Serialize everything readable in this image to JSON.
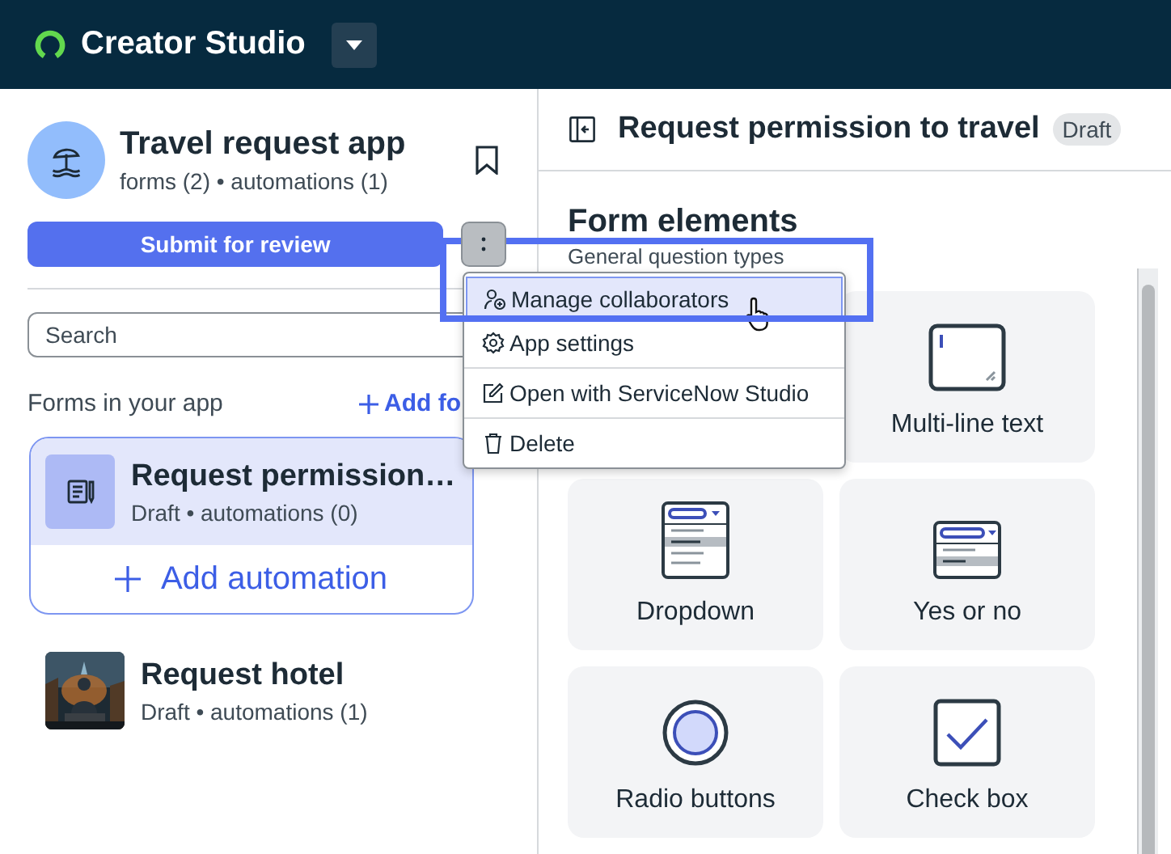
{
  "header": {
    "title": "Creator Studio"
  },
  "app": {
    "name": "Travel request app",
    "summary": "forms (2) • automations (1)"
  },
  "submit_button": "Submit for review",
  "search": {
    "placeholder": "Search"
  },
  "forms_section": {
    "label": "Forms in your app",
    "add_link": "Add fo"
  },
  "forms": [
    {
      "title": "Request permission…",
      "subtitle": "Draft • automations (0)",
      "selected": true,
      "kind": "icon",
      "add_action": "Add automation"
    },
    {
      "title": "Request hotel",
      "subtitle": "Draft • automations (1)",
      "selected": false,
      "kind": "picture"
    }
  ],
  "menu": {
    "items": [
      {
        "label": "Manage collaborators",
        "kind": "collaborators",
        "selected": true
      },
      {
        "label": "App settings",
        "kind": "settings",
        "selected": false
      },
      {
        "label": "Open with ServiceNow Studio",
        "kind": "edit",
        "selected": false
      },
      {
        "label": "Delete",
        "kind": "delete",
        "selected": false
      }
    ]
  },
  "editor": {
    "title": "Request permission to travel",
    "status": "Draft",
    "heading": "Form elements",
    "subheading": "General question types",
    "elements": [
      {
        "label": "Multi-line text",
        "kind": "multiline"
      },
      {
        "label": "Dropdown",
        "kind": "dropdown"
      },
      {
        "label": "Yes or no",
        "kind": "yesno"
      },
      {
        "label": "Radio buttons",
        "kind": "radio"
      },
      {
        "label": "Check box",
        "kind": "checkbox"
      }
    ]
  }
}
